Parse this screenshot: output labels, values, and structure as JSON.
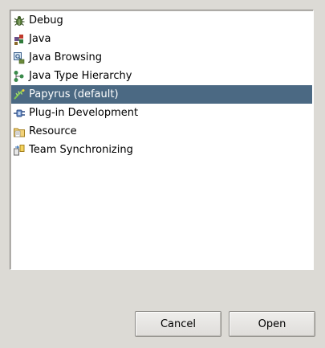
{
  "perspectives": [
    {
      "label": "Debug",
      "icon": "bug-icon"
    },
    {
      "label": "Java",
      "icon": "java-perspective-icon"
    },
    {
      "label": "Java Browsing",
      "icon": "java-browsing-icon"
    },
    {
      "label": "Java Type Hierarchy",
      "icon": "type-hierarchy-icon"
    },
    {
      "label": "Papyrus (default)",
      "icon": "papyrus-icon",
      "selected": true
    },
    {
      "label": "Plug-in Development",
      "icon": "plugin-development-icon"
    },
    {
      "label": "Resource",
      "icon": "resource-folder-icon"
    },
    {
      "label": "Team Synchronizing",
      "icon": "team-synchronizing-icon"
    }
  ],
  "buttons": {
    "cancel_label": "Cancel",
    "open_label": "Open"
  },
  "colors": {
    "selection_bg": "#4b6983",
    "selection_fg": "#ffffff",
    "window_bg": "#dcdad5"
  }
}
